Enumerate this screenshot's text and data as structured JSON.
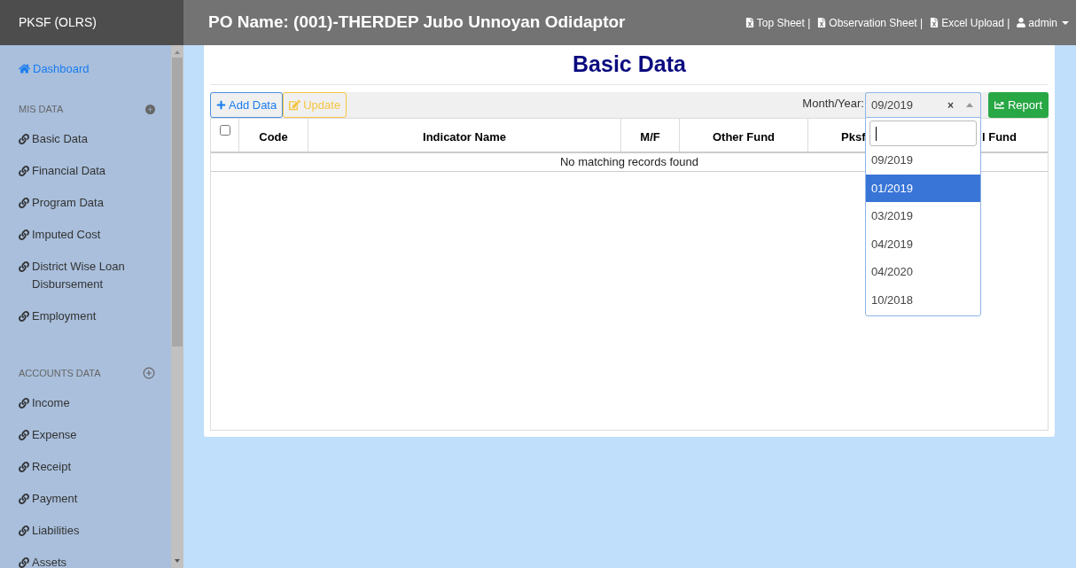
{
  "brand": "PKSF (OLRS)",
  "header": {
    "title": "PO Name: (001)-THERDEP Jubo Unnoyan Odidaptor",
    "links": [
      {
        "label": "Top Sheet |"
      },
      {
        "label": "Observation Sheet |"
      },
      {
        "label": "Excel Upload |"
      }
    ],
    "user": "admin"
  },
  "sidebar": {
    "items": [
      {
        "label": "Dashboard",
        "selected": true
      }
    ],
    "sections": [
      {
        "title": "MIS DATA",
        "items": [
          {
            "label": "Basic Data"
          },
          {
            "label": "Financial Data"
          },
          {
            "label": "Program Data"
          },
          {
            "label": "Imputed Cost"
          },
          {
            "label": "District Wise Loan Disbursement"
          },
          {
            "label": "Employment"
          }
        ]
      },
      {
        "title": "ACCOUNTS DATA",
        "items": [
          {
            "label": "Income"
          },
          {
            "label": "Expense"
          },
          {
            "label": "Receipt"
          },
          {
            "label": "Payment"
          },
          {
            "label": "Liabilities"
          },
          {
            "label": "Assets"
          }
        ]
      }
    ]
  },
  "page_title": "Basic Data",
  "toolbar": {
    "buttons": [
      {
        "kind": "add",
        "label": "Add Data"
      },
      {
        "kind": "update",
        "label": "Update"
      }
    ],
    "month_label": "Month/Year:",
    "month_value": "09/2019",
    "clear": "×",
    "report": "Report"
  },
  "table": {
    "select_all_checked": false,
    "columns": [
      "Code",
      "Indicator Name",
      "M/F",
      "Other Fund",
      "Pksf",
      "l Fund"
    ],
    "empty_message": "No matching records found"
  },
  "dropdown": {
    "options": [
      {
        "label": "09/2019",
        "selected": false
      },
      {
        "label": "01/2019",
        "selected": true
      },
      {
        "label": "03/2019",
        "selected": false
      },
      {
        "label": "04/2019",
        "selected": false
      },
      {
        "label": "04/2020",
        "selected": false
      },
      {
        "label": "10/2018",
        "selected": false
      }
    ]
  }
}
